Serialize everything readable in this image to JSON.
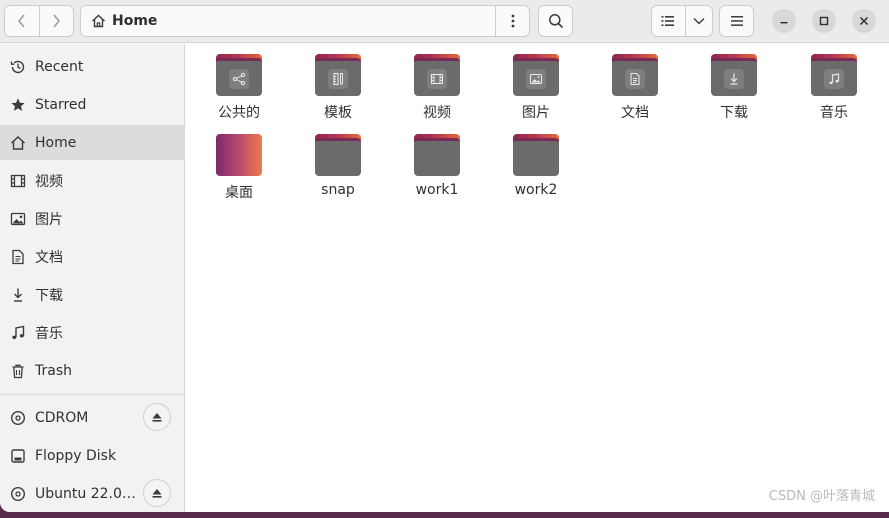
{
  "header": {
    "back_icon": "chevron-left-icon",
    "forward_icon": "chevron-right-icon",
    "path": "Home",
    "search_icon": "search-icon",
    "view_list_icon": "list-view-icon",
    "view_dropdown_icon": "chevron-down-icon",
    "menu_icon": "hamburger-menu-icon",
    "minimize_icon": "minimize-icon",
    "maximize_icon": "maximize-icon",
    "close_icon": "close-icon"
  },
  "sidebar": {
    "items": [
      {
        "label": "Recent",
        "icon": "clock-icon"
      },
      {
        "label": "Starred",
        "icon": "star-icon"
      },
      {
        "label": "Home",
        "icon": "home-icon",
        "active": true
      },
      {
        "label": "视频",
        "icon": "film-icon"
      },
      {
        "label": "图片",
        "icon": "image-icon"
      },
      {
        "label": "文档",
        "icon": "document-icon"
      },
      {
        "label": "下载",
        "icon": "download-icon"
      },
      {
        "label": "音乐",
        "icon": "music-icon"
      },
      {
        "label": "Trash",
        "icon": "trash-icon"
      }
    ],
    "devices": [
      {
        "label": "CDROM",
        "icon": "disc-icon",
        "eject": true
      },
      {
        "label": "Floppy Disk",
        "icon": "drive-icon",
        "eject": false
      },
      {
        "label": "Ubuntu 22.0…",
        "icon": "disc-icon",
        "eject": true
      }
    ]
  },
  "folders": [
    {
      "label": "公共的",
      "emblem": "share-icon"
    },
    {
      "label": "模板",
      "emblem": "template-icon"
    },
    {
      "label": "视频",
      "emblem": "film-icon"
    },
    {
      "label": "图片",
      "emblem": "image-icon"
    },
    {
      "label": "文档",
      "emblem": "document-icon"
    },
    {
      "label": "下载",
      "emblem": "download-icon"
    },
    {
      "label": "音乐",
      "emblem": "music-icon"
    },
    {
      "label": "桌面",
      "emblem": "desktop-icon"
    },
    {
      "label": "snap",
      "emblem": ""
    },
    {
      "label": "work1",
      "emblem": ""
    },
    {
      "label": "work2",
      "emblem": ""
    }
  ],
  "watermark": "CSDN @叶落青城"
}
